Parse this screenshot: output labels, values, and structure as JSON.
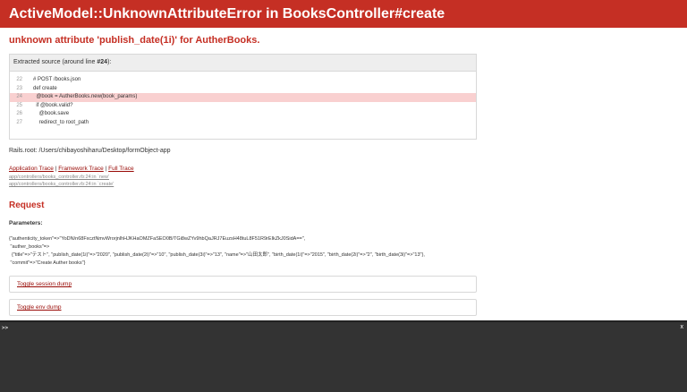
{
  "header": {
    "title": "ActiveModel::UnknownAttributeError in BooksController#create"
  },
  "error_message": "unknown attribute 'publish_date(1i)' for AutherBooks.",
  "source": {
    "head_prefix": "Extracted source (around line ",
    "head_line": "#24",
    "head_suffix": "):",
    "lines": [
      {
        "num": "22",
        "code": "# POST /books.json"
      },
      {
        "num": "23",
        "code": "def create"
      },
      {
        "num": "24",
        "code": "  @book = AutherBooks.new(book_params)"
      },
      {
        "num": "25",
        "code": "  if @book.valid?"
      },
      {
        "num": "26",
        "code": "    @book.save"
      },
      {
        "num": "27",
        "code": "    redirect_to root_path"
      }
    ]
  },
  "rails_root": "Rails.root: /Users/chibayoshiharu/Desktop/formObject-app",
  "traces": {
    "application": "Application Trace",
    "framework": "Framework Trace",
    "full": "Full Trace",
    "sep": "|",
    "lines": [
      "app/controllers/books_controller.rb:24:in `new'",
      "app/controllers/books_controller.rb:24:in `create'"
    ]
  },
  "request": {
    "heading": "Request",
    "params_label": "Parameters",
    "params_label_suffix": ":",
    "params_lines": [
      "{\"authenticity_token\"=>\"YoDN/n68FxcztNmvWrorjnlhHJKHaOMZFaSEO0B/TGi8wZYv9hbQaJRJ7EuzsH48tuL8F51R9rEIkZkJ0SidA==\",",
      " \"auther_books\"=>",
      "  {\"title\"=>\"テスト\", \"publish_date(1i)\"=>\"2020\", \"publish_date(2i)\"=>\"10\", \"publish_date(3i)\"=>\"13\", \"name\"=>\"山田太郎\", \"birth_date(1i)\"=>\"2015\", \"birth_date(2i)\"=>\"2\", \"birth_date(3i)\"=>\"13\"},",
      " \"commit\"=>\"Create Auther books\"}"
    ],
    "toggle_session": "Toggle session dump",
    "toggle_env": "Toggle env dump"
  },
  "console": {
    "prompt": ">>",
    "close": "x"
  }
}
